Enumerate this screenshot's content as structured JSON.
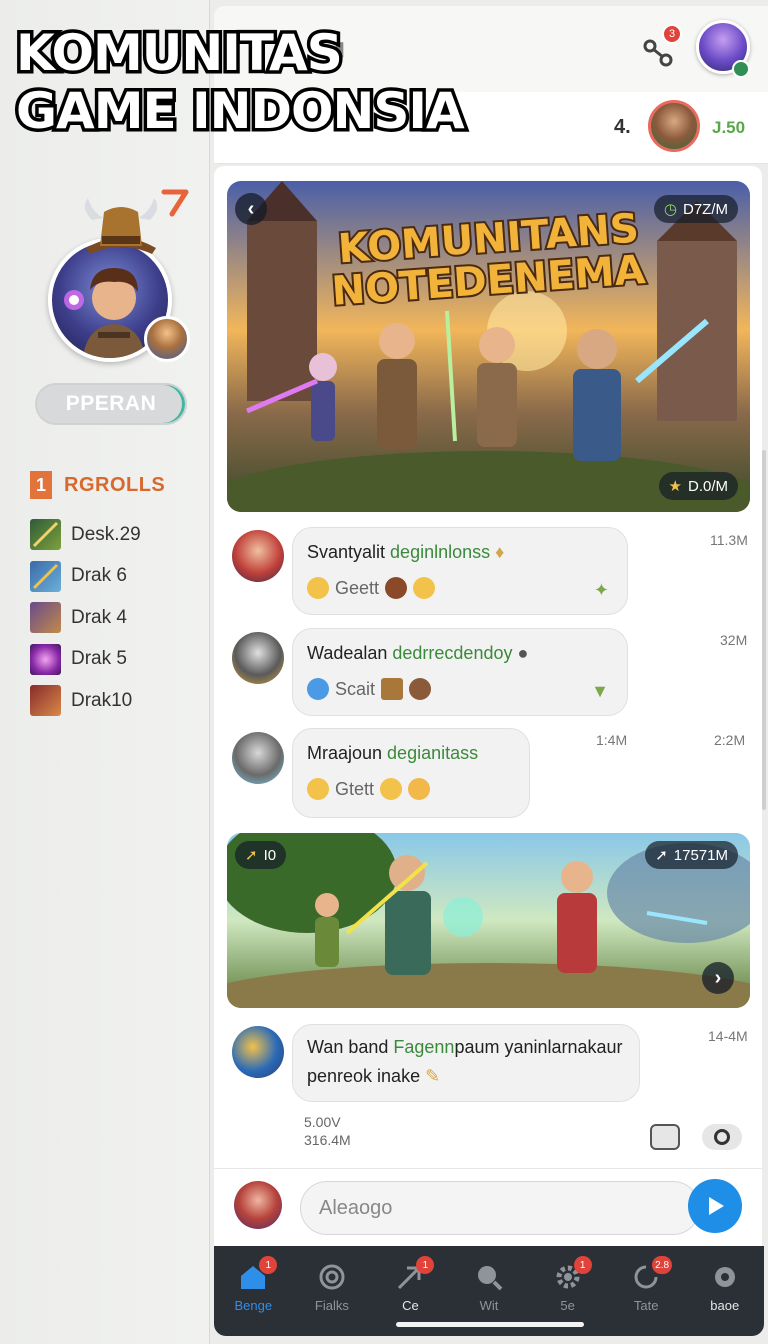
{
  "overlay": {
    "line1": "KOMUNITAS",
    "line2": "GAME INDONSIA"
  },
  "topbar": {
    "notification_count": "3"
  },
  "subbar": {
    "count": "4.",
    "value": "J.50"
  },
  "sidebar": {
    "role_label": "PPERAN",
    "rank_number": "1",
    "rank_title": "RGROLLS",
    "items": [
      {
        "label": "Desk.29"
      },
      {
        "label": "Drak 6"
      },
      {
        "label": "Drak 4"
      },
      {
        "label": "Drak 5"
      },
      {
        "label": "Drak10"
      }
    ]
  },
  "banner": {
    "title_line1": "KOMUNITANS",
    "title_line2": "NOTEDENEMA",
    "top_badge": "D7Z/M",
    "bottom_badge": "D.0/M"
  },
  "messages": [
    {
      "text": "Svantyalit ",
      "green": "deginlnlonss",
      "reaction_label": "Geett",
      "time": "11.3M"
    },
    {
      "text": "Wadealan ",
      "green": "dedrrecdendoy",
      "reaction_label": "Scait",
      "time": "32M"
    },
    {
      "text": "Mraajoun ",
      "green": "degianitass",
      "reaction_label": "Gtett",
      "time_mid": "1:4M",
      "time": "2:2M"
    }
  ],
  "banner2": {
    "left_badge": "I0",
    "right_badge": "17571M"
  },
  "last_message": {
    "line1_a": "Wan band ",
    "line1_green": "Fagenn",
    "line1_b": "paum yaninlarnakaur",
    "line2": "penreok inake",
    "time": "14-4M",
    "meta1": "5.00V",
    "meta2": "316.4M"
  },
  "input": {
    "placeholder": "Aleaogo"
  },
  "nav": {
    "items": [
      {
        "label": "Benge",
        "badge": "1"
      },
      {
        "label": "Fialks",
        "badge": ""
      },
      {
        "label": "Ce",
        "badge": "1"
      },
      {
        "label": "Wit",
        "badge": ""
      },
      {
        "label": "5e",
        "badge": "1"
      },
      {
        "label": "Tate",
        "badge": "2.8"
      },
      {
        "label": "baoe",
        "badge": ""
      }
    ]
  },
  "colors": {
    "accent_blue": "#1f8ee6",
    "rank_orange": "#d9682c",
    "green_text": "#3b8a3b",
    "nav_bg": "#2b2f36"
  }
}
